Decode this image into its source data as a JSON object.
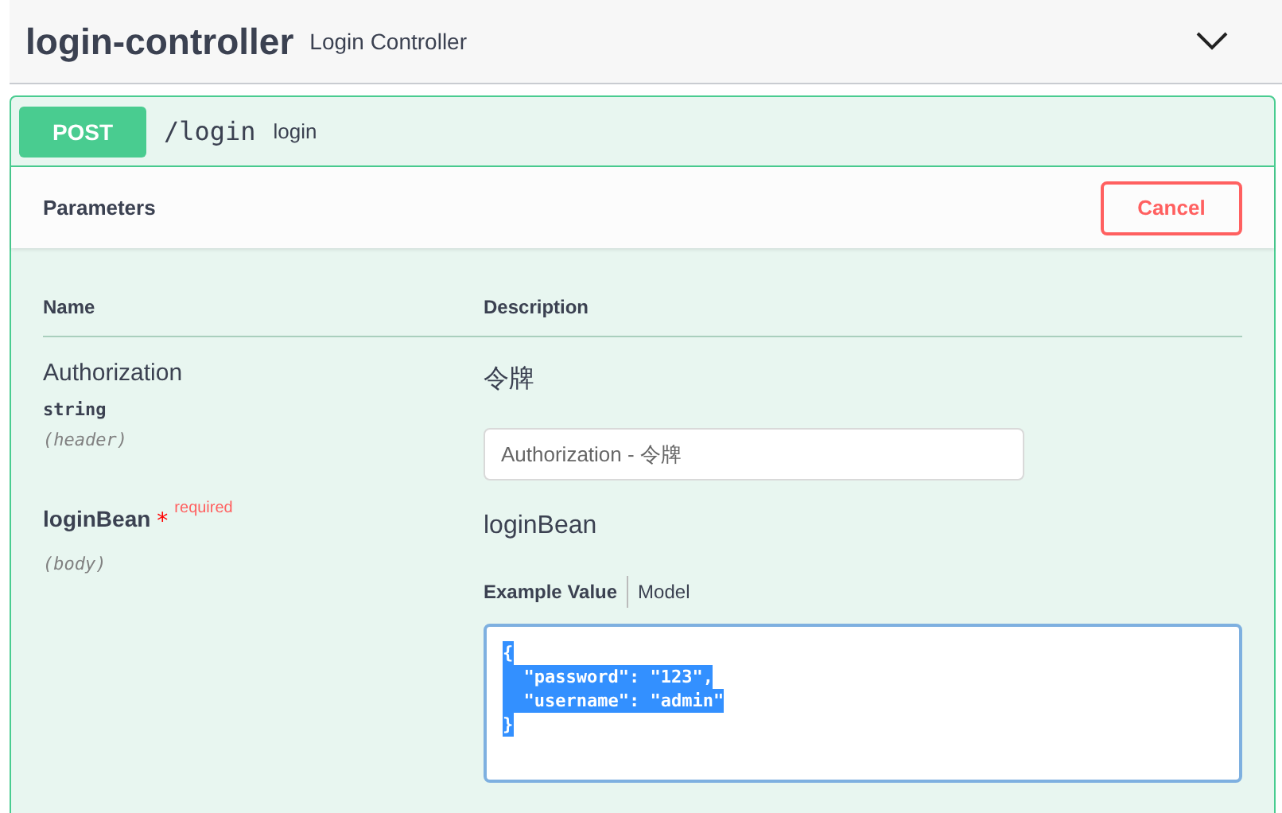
{
  "tag": {
    "name": "login-controller",
    "description": "Login Controller",
    "expanded": true
  },
  "operation": {
    "method": "POST",
    "path": "/login",
    "summary": "login"
  },
  "parameters_section": {
    "title": "Parameters",
    "cancel_button": "Cancel"
  },
  "table": {
    "columns": [
      "Name",
      "Description"
    ],
    "rows": [
      {
        "kind": "header",
        "name": "Authorization",
        "required": false,
        "type": "string",
        "location": "(header)",
        "description": "令牌",
        "placeholder": "Authorization - 令牌"
      },
      {
        "kind": "body",
        "name": "loginBean",
        "required": true,
        "required_mark": "*",
        "required_label": "required",
        "location": "(body)",
        "description": "loginBean",
        "tabs": [
          {
            "label": "Example Value",
            "selected": true
          },
          {
            "label": "Model",
            "selected": false
          }
        ],
        "example": {
          "selected": true,
          "lines": [
            "{",
            "  \"password\": \"123\",",
            "  \"username\": \"admin\"",
            "}"
          ]
        }
      }
    ]
  }
}
